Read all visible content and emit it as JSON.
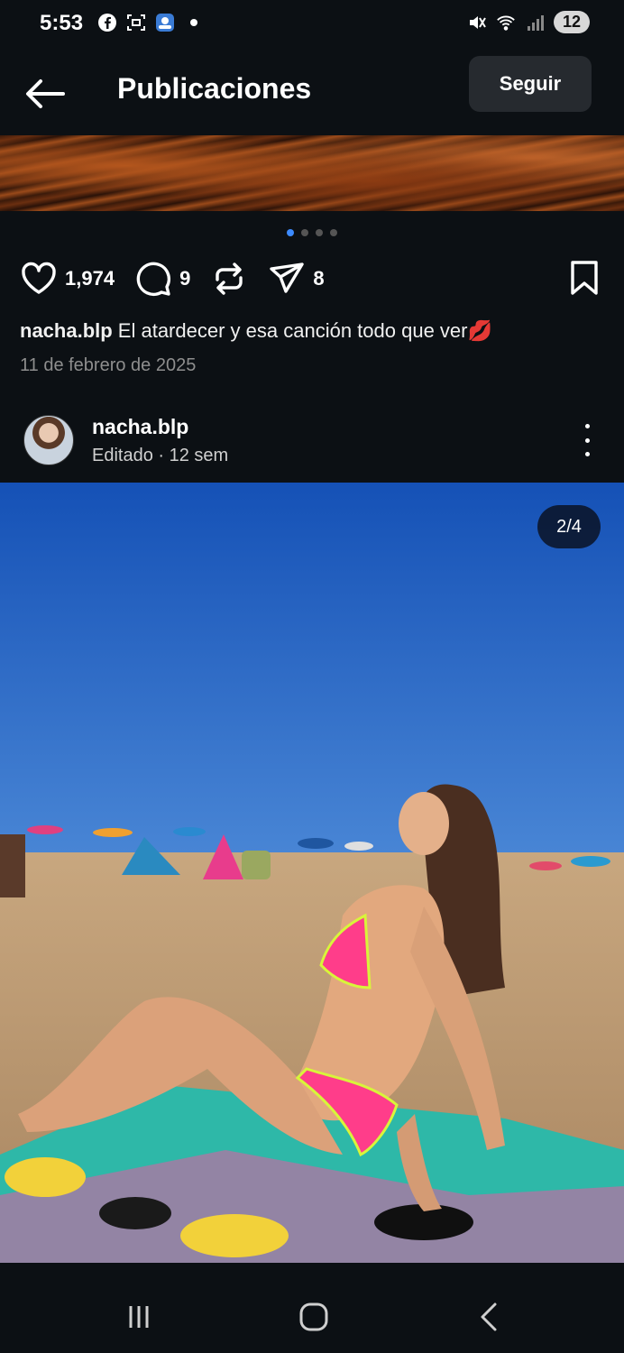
{
  "status_bar": {
    "time": "5:53",
    "battery": "12",
    "icons": [
      "facebook-icon",
      "screenshot-icon",
      "gallery-icon",
      "notification-dot-icon",
      "mute-icon",
      "wifi-icon",
      "signal-icon"
    ]
  },
  "header": {
    "title": "Publicaciones",
    "follow_label": "Seguir",
    "back_icon": "arrow-left-icon"
  },
  "previous_post": {
    "carousel_pages": 4,
    "carousel_active": 1,
    "likes": "1,974",
    "comments": "9",
    "shares": "8",
    "username": "nacha.blp",
    "caption": " El atardecer y esa canción todo que ver💋",
    "date": "11 de febrero de 2025"
  },
  "current_post": {
    "username": "nacha.blp",
    "meta": "Editado · 12 sem",
    "counter": "2/4"
  },
  "nav_bar": {
    "icons": [
      "recent-apps-icon",
      "home-icon",
      "back-icon"
    ]
  },
  "colors": {
    "background": "#0c1014",
    "follow_button": "#262a2f",
    "active_dot": "#3d8bff",
    "muted_text": "#8e8e8e"
  }
}
